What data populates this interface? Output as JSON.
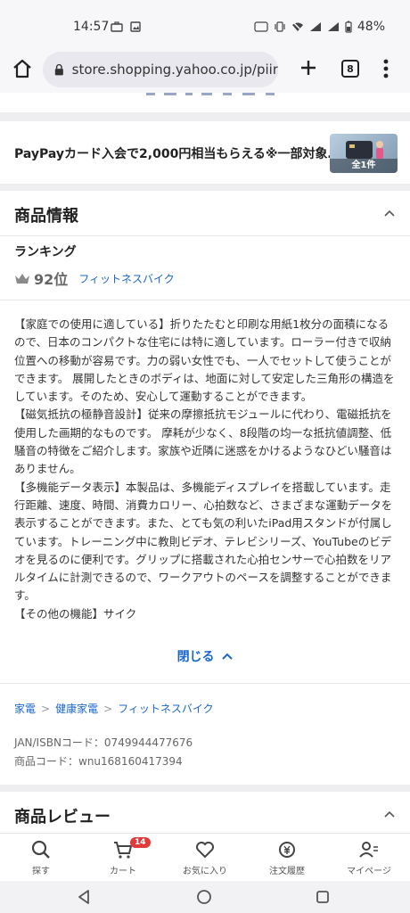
{
  "status_bar": {
    "time": "14:57",
    "battery": "48%"
  },
  "browser": {
    "url": "store.shopping.yahoo.co.jp/piir",
    "tab_count": "8"
  },
  "promo": {
    "text": "PayPayカード入会で2,000円相当もらえる※一部対象…",
    "badge": "全1件"
  },
  "product_info": {
    "title": "商品情報",
    "ranking_label": "ランキング",
    "rank": "92位",
    "rank_category": "フィットネスバイク",
    "description": [
      "【家庭での使用に適している】折りたたむと印刷な用紙1枚分の面積になるので、日本のコンパクトな住宅には特に適しています。ローラー付きで収納位置への移動が容易です。力の弱い女性でも、一人でセットして使うことができます。 展開したときのボディは、地面に対して安定した三角形の構造をしています。そのため、安心して運動することができます。",
      "【磁気抵抗の極静音設計】従来の摩擦抵抗モジュールに代わり、電磁抵抗を使用した画期的なものです。 摩耗が少なく、8段階の均一な抵抗値調整、低騒音の特徴をご紹介します。家族や近隣に迷惑をかけるようなひどい騒音はありません。",
      "【多機能データ表示】本製品は、多機能ディスプレイを搭載しています。走行距離、速度、時間、消費カロリー、心拍数など、さまざまな運動データを表示することができます。また、とても気の利いたiPad用スタンドが付属しています。トレーニング中に教則ビデオ、テレビシリーズ、YouTubeのビデオを見るのに便利です。グリップに搭載された心拍センサーで心拍数をリアルタイムに計測できるので、ワークアウトのペースを調整することができます。",
      "【その他の機能】サイク"
    ],
    "close_label": "閉じる",
    "breadcrumb": [
      "家電",
      "健康家電",
      "フィットネスバイク"
    ],
    "jan_code": "JAN/ISBNコード：0749944477676",
    "product_code": "商品コード：wnu168160417394"
  },
  "reviews": {
    "title": "商品レビュー"
  },
  "bottom_nav": {
    "search": "探す",
    "cart": "カート",
    "cart_count": "14",
    "favorites": "お気に入り",
    "orders": "注文履歴",
    "mypage": "マイページ"
  }
}
